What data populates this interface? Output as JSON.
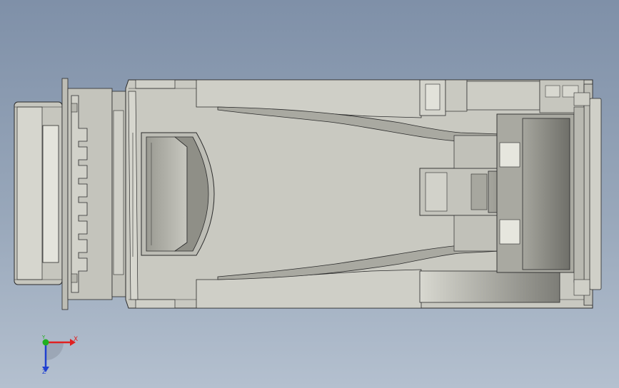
{
  "view": {
    "colors": {
      "background_top": "#7f90a8",
      "background_bottom": "#b4c0cf",
      "body_fill": "#c9c9c1",
      "edge_line": "#2b2b2b",
      "shade_dark": "#8c8c86",
      "shade_mid": "#b0b0a8",
      "shade_light": "#dcdcd4"
    }
  },
  "triad": {
    "x_label": "X",
    "y_label": "Y",
    "z_label": "Z",
    "x_color": "#e02020",
    "y_color": "#20b020",
    "z_color": "#2040d0"
  }
}
